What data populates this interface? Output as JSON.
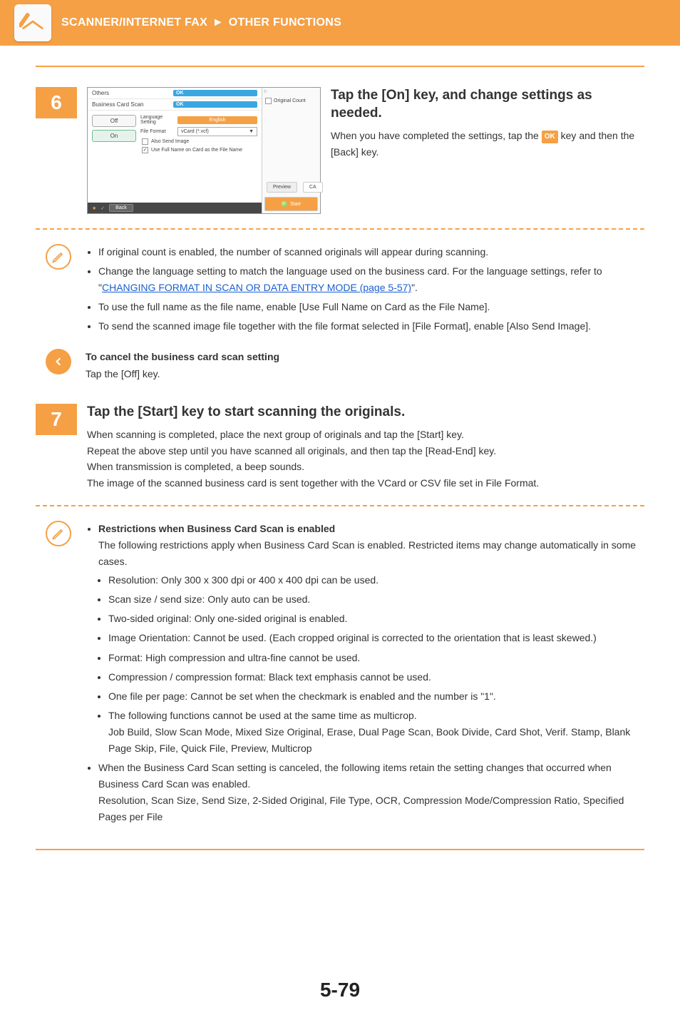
{
  "header": {
    "breadcrumb_left": "SCANNER/INTERNET FAX",
    "breadcrumb_sep": "►",
    "breadcrumb_right": "OTHER FUNCTIONS"
  },
  "step6": {
    "number": "6",
    "heading": "Tap the [On] key, and change settings as needed.",
    "body_before": "When you have completed the settings, tap the ",
    "ok_label": "OK",
    "body_after": " key and then the [Back] key.",
    "ui": {
      "title": "Others",
      "subtitle": "Business Card Scan",
      "ok": "OK",
      "off": "Off",
      "on": "On",
      "lang_label": "Language Setting",
      "lang_value": "English",
      "format_label": "File Format",
      "format_value": "vCard (*.vcf)",
      "also_send": "Also Send Image",
      "full_name": "Use Full Name on Card as the File Name",
      "back": "Back",
      "orig_count": "Original Count",
      "preview": "Preview",
      "ca": "CA",
      "start": "Start"
    }
  },
  "notes6": {
    "b1": "If original count is enabled, the number of scanned originals will appear during scanning.",
    "b2_before": "Change the language setting to match the language used on the business card. For the language settings, refer to \"",
    "b2_link": "CHANGING FORMAT IN SCAN OR DATA ENTRY MODE (page 5-57)",
    "b2_after": "\".",
    "b3": "To use the full name as the file name, enable [Use Full Name on Card as the File Name].",
    "b4": "To send the scanned image file together with the file format selected in [File Format], enable [Also Send Image]."
  },
  "cancel_note": {
    "title": "To cancel the business card scan setting",
    "body": "Tap the [Off] key."
  },
  "step7": {
    "number": "7",
    "heading": "Tap the [Start] key to start scanning the originals.",
    "line1": "When scanning is completed, place the next group of originals and tap the [Start] key.",
    "line2": "Repeat the above step until you have scanned all originals, and then tap the [Read-End] key.",
    "line3": "When transmission is completed, a beep sounds.",
    "line4": "The image of the scanned business card is sent together with the VCard or CSV file set in File Format."
  },
  "restrictions": {
    "title": "Restrictions when Business Card Scan is enabled",
    "intro": "The following restrictions apply when Business Card Scan is enabled. Restricted items may change automatically in some cases.",
    "items": {
      "r1": "Resolution: Only 300 x 300 dpi or 400 x 400 dpi can be used.",
      "r2": "Scan size / send size: Only auto can be used.",
      "r3": "Two-sided original: Only one-sided original is enabled.",
      "r4": "Image Orientation: Cannot be used. (Each cropped original is corrected to the orientation that is least skewed.)",
      "r5": "Format: High compression and ultra-fine cannot be used.",
      "r6": "Compression / compression format: Black text emphasis cannot be used.",
      "r7": "One file per page: Cannot be set when the checkmark is enabled and the number is \"1\".",
      "r8a": "The following functions cannot be used at the same time as multicrop.",
      "r8b": "Job Build, Slow Scan Mode, Mixed Size Original, Erase, Dual Page Scan, Book Divide, Card Shot, Verif. Stamp, Blank Page Skip, File, Quick File, Preview, Multicrop"
    },
    "retain1": "When the Business Card Scan setting is canceled, the following items retain the setting changes that occurred when Business Card Scan was enabled.",
    "retain2": "Resolution, Scan Size, Send Size, 2-Sided Original, File Type, OCR, Compression Mode/Compression Ratio, Specified Pages per File"
  },
  "page_number": "5-79"
}
